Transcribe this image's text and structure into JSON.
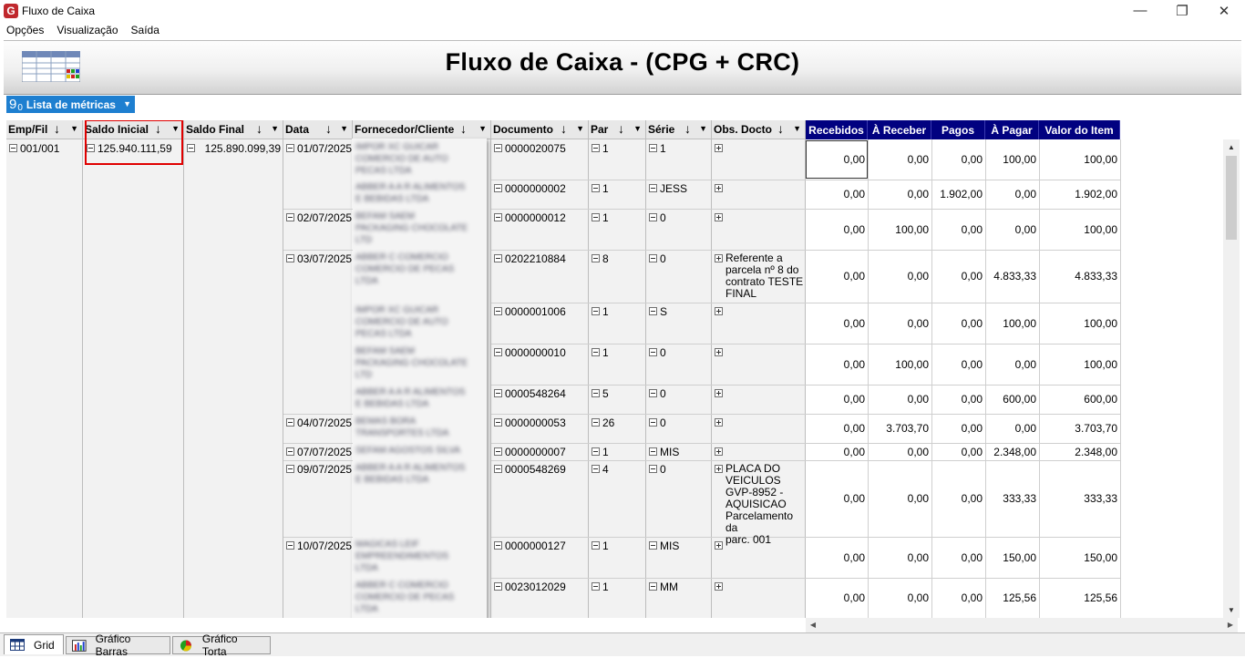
{
  "window": {
    "title": "Fluxo de Caixa",
    "app_icon": "G",
    "min": "—",
    "restore": "❐",
    "close": "✕"
  },
  "menu": [
    "Opções",
    "Visualização",
    "Saída"
  ],
  "header": {
    "title": "Fluxo de Caixa - (CPG + CRC)"
  },
  "metrics_button": {
    "prefix_main": "9",
    "prefix_sub": "0",
    "label": "Lista de métricas"
  },
  "columns": {
    "dims": [
      "Emp/Fil",
      "Saldo Inicial",
      "Saldo Final",
      "Data",
      "Fornecedor/Cliente",
      "Documento",
      "Par",
      "Série",
      "Obs. Docto"
    ],
    "metrics": [
      "Recebidos",
      "À Receber",
      "Pagos",
      "À Pagar",
      "Valor do Item"
    ]
  },
  "grid": {
    "emp_fil": "001/001",
    "saldo_inicial": "125.940.111,59",
    "saldo_final": "125.890.099,39",
    "dates": [
      "01/07/2025",
      "02/07/2025",
      "03/07/2025",
      "04/07/2025",
      "07/07/2025",
      "09/07/2025",
      "10/07/2025"
    ],
    "rows": [
      {
        "fornecedor": [
          "IMPOR XC GUICAR",
          "COMERCIO DE AUTO",
          "PECAS LTDA"
        ],
        "documento": "0000020075",
        "par": "1",
        "serie": "1",
        "obs": "",
        "recebidos": "0,00",
        "a_receber": "0,00",
        "pagos": "0,00",
        "a_pagar": "100,00",
        "valor": "100,00"
      },
      {
        "fornecedor": [
          "ABBER A A R ALIMENTOS",
          "E BEBIDAS LTDA"
        ],
        "documento": "0000000002",
        "par": "1",
        "serie": "JESS",
        "obs": "",
        "recebidos": "0,00",
        "a_receber": "0,00",
        "pagos": "1.902,00",
        "a_pagar": "0,00",
        "valor": "1.902,00"
      },
      {
        "fornecedor": [
          "BEFAM SAEM",
          "PACKAGING CHOCOLATE",
          "LTD"
        ],
        "documento": "0000000012",
        "par": "1",
        "serie": "0",
        "obs": "",
        "recebidos": "0,00",
        "a_receber": "100,00",
        "pagos": "0,00",
        "a_pagar": "0,00",
        "valor": "100,00"
      },
      {
        "fornecedor": [
          "ABBER C COMERCIO",
          "COMERCIO DE PECAS",
          "LTDA"
        ],
        "documento": "0202210884",
        "par": "8",
        "serie": "0",
        "obs": [
          "Referente a",
          "parcela nº 8 do",
          "contrato TESTE",
          "FINAL"
        ],
        "recebidos": "0,00",
        "a_receber": "0,00",
        "pagos": "0,00",
        "a_pagar": "4.833,33",
        "valor": "4.833,33"
      },
      {
        "fornecedor": [
          "IMPOR XC GUICAR",
          "COMERCIO DE AUTO",
          "PECAS LTDA"
        ],
        "documento": "0000001006",
        "par": "1",
        "serie": "S",
        "obs": "",
        "recebidos": "0,00",
        "a_receber": "0,00",
        "pagos": "0,00",
        "a_pagar": "100,00",
        "valor": "100,00"
      },
      {
        "fornecedor": [
          "BEFAM SAEM",
          "PACKAGING CHOCOLATE",
          "LTD"
        ],
        "documento": "0000000010",
        "par": "1",
        "serie": "0",
        "obs": "",
        "recebidos": "0,00",
        "a_receber": "100,00",
        "pagos": "0,00",
        "a_pagar": "0,00",
        "valor": "100,00"
      },
      {
        "fornecedor": [
          "ABBER A A R ALIMENTOS",
          "E BEBIDAS LTDA"
        ],
        "documento": "0000548264",
        "par": "5",
        "serie": "0",
        "obs": "",
        "recebidos": "0,00",
        "a_receber": "0,00",
        "pagos": "0,00",
        "a_pagar": "600,00",
        "valor": "600,00"
      },
      {
        "fornecedor": [
          "BEMAS BORA",
          "TRANSPORTES LTDA"
        ],
        "documento": "0000000053",
        "par": "26",
        "serie": "0",
        "obs": "",
        "recebidos": "0,00",
        "a_receber": "3.703,70",
        "pagos": "0,00",
        "a_pagar": "0,00",
        "valor": "3.703,70"
      },
      {
        "fornecedor": [
          "SEFAM AGOSTOS SILVA"
        ],
        "documento": "0000000007",
        "par": "1",
        "serie": "MIS",
        "obs": "",
        "recebidos": "0,00",
        "a_receber": "0,00",
        "pagos": "0,00",
        "a_pagar": "2.348,00",
        "valor": "2.348,00"
      },
      {
        "fornecedor": [
          "ABBER A A R ALIMENTOS",
          "E BEBIDAS LTDA"
        ],
        "documento": "0000548269",
        "par": "4",
        "serie": "0",
        "obs": [
          "PLACA DO",
          "VEICULOS",
          "GVP-8952 -",
          "AQUISICAO",
          "Parcelamento da",
          "parc. 001"
        ],
        "recebidos": "0,00",
        "a_receber": "0,00",
        "pagos": "0,00",
        "a_pagar": "333,33",
        "valor": "333,33"
      },
      {
        "fornecedor": [
          "MAGICAS LEIF",
          "EMPREENDIMENTOS",
          "LTDA"
        ],
        "documento": "0000000127",
        "par": "1",
        "serie": "MIS",
        "obs": "",
        "recebidos": "0,00",
        "a_receber": "0,00",
        "pagos": "0,00",
        "a_pagar": "150,00",
        "valor": "150,00"
      },
      {
        "fornecedor": [
          "ABBER C COMERCIO",
          "COMERCIO DE PECAS",
          "LTDA"
        ],
        "documento": "0023012029",
        "par": "1",
        "serie": "MM",
        "obs": "",
        "recebidos": "0,00",
        "a_receber": "0,00",
        "pagos": "0,00",
        "a_pagar": "125,56",
        "valor": "125,56"
      }
    ]
  },
  "tabs": [
    "Grid",
    "Gráfico Barras",
    "Gráfico Torta"
  ],
  "colors": {
    "metric_header_bg": "#010180",
    "metrics_button_bg": "#1e7fd0",
    "highlight_box": "#e00000"
  }
}
